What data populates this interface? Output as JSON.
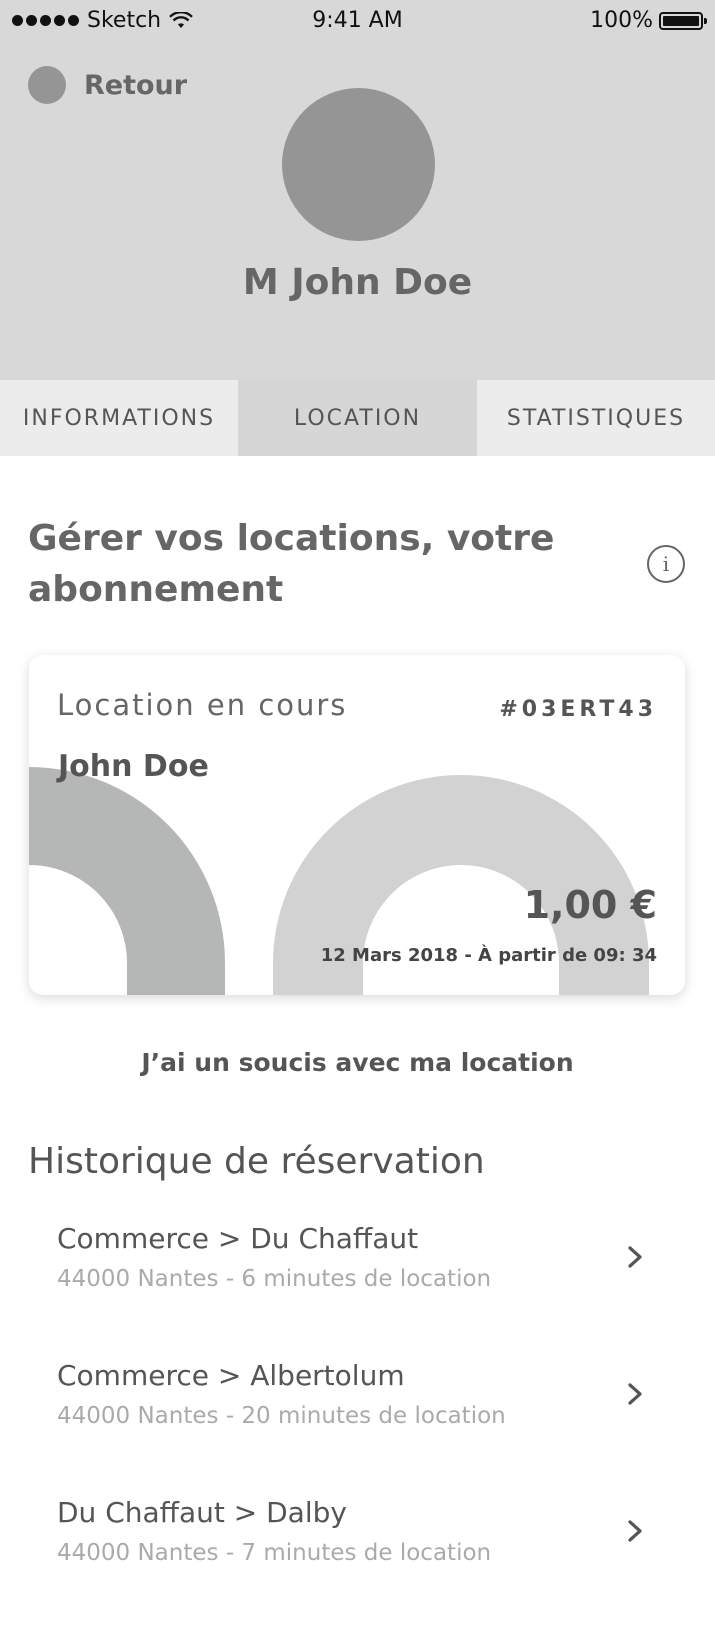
{
  "status_bar": {
    "carrier": "Sketch",
    "time": "9:41 AM",
    "battery": "100%"
  },
  "header": {
    "back_label": "Retour",
    "user_name": "M John Doe"
  },
  "tabs": [
    {
      "label": "INFORMATIONS",
      "active": false
    },
    {
      "label": "LOCATION",
      "active": true
    },
    {
      "label": "STATISTIQUES",
      "active": false
    }
  ],
  "section": {
    "title": "Gérer vos locations, votre abonnement",
    "info_icon": "i"
  },
  "current_rental": {
    "label": "Location en cours",
    "reference": "#03ERT43",
    "name": "John Doe",
    "price": "1,00 €",
    "date": "12 Mars 2018 - À partir de 09: 34"
  },
  "issue_link": "J’ai un soucis avec ma location",
  "history": {
    "title": "Historique de réservation",
    "items": [
      {
        "title": "Commerce > Du Chaffaut",
        "subtitle": "44000 Nantes - 6 minutes de location"
      },
      {
        "title": "Commerce > Albertolum",
        "subtitle": "44000 Nantes - 20 minutes de location"
      },
      {
        "title": "Du Chaffaut > Dalby",
        "subtitle": "44000 Nantes - 7 minutes de location"
      }
    ]
  },
  "colors": {
    "header_bg": "#d8d8d8",
    "placeholder_circle": "#959595",
    "arc_dark": "#b4b7b6",
    "arc_light": "#d2d2d2"
  }
}
